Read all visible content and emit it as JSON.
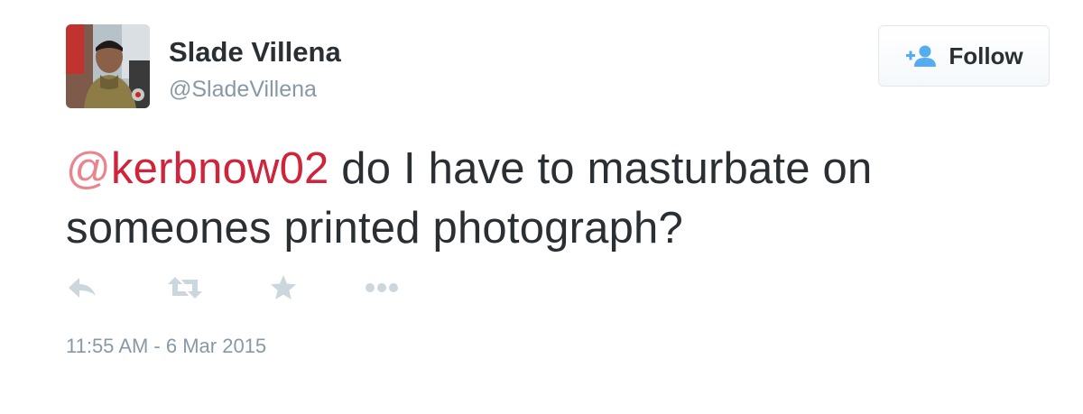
{
  "user": {
    "display_name": "Slade Villena",
    "screen_name": "@SladeVillena"
  },
  "follow_button": {
    "label": "Follow",
    "icon": "follow-user-icon"
  },
  "tweet": {
    "mention_at": "@",
    "mention_handle": "kerbnow02",
    "text_line1": " do I have to masturbate on",
    "text_line2": "someones printed photograph?"
  },
  "actions": [
    {
      "name": "reply",
      "icon": "reply-icon"
    },
    {
      "name": "retweet",
      "icon": "retweet-icon"
    },
    {
      "name": "favorite",
      "icon": "star-icon"
    },
    {
      "name": "more",
      "icon": "more-dots-icon"
    }
  ],
  "timestamp": "11:55 AM - 6 Mar 2015",
  "colors": {
    "text": "#292f33",
    "muted": "#8899a6",
    "mention": "#d0243b",
    "mention_at": "#e8858f",
    "icon": "#ccd6dd",
    "follow_icon": "#55acee"
  }
}
